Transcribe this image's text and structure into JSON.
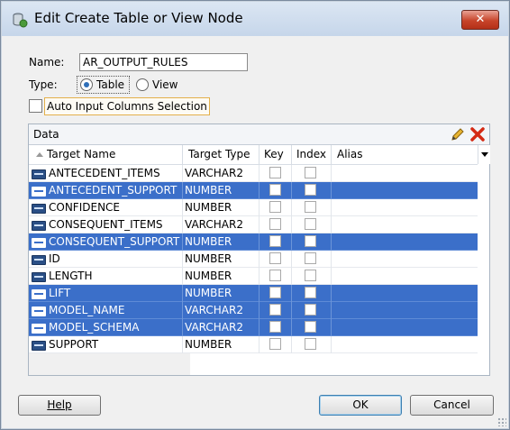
{
  "window": {
    "title": "Edit Create Table or View Node",
    "close_label": "✕"
  },
  "form": {
    "name_label": "Name:",
    "name_value": "AR_OUTPUT_RULES",
    "type_label": "Type:",
    "type_options": [
      "Table",
      "View"
    ],
    "type_selected": "Table",
    "auto_input_label": "Auto Input Columns Selection",
    "auto_input_checked": false
  },
  "data_panel": {
    "title": "Data",
    "columns": [
      "Target Name",
      "Target Type",
      "Key",
      "Index",
      "Alias"
    ],
    "rows": [
      {
        "name": "ANTECEDENT_ITEMS",
        "type": "VARCHAR2",
        "key": false,
        "index": false,
        "alias": "",
        "selected": false
      },
      {
        "name": "ANTECEDENT_SUPPORT",
        "type": "NUMBER",
        "key": false,
        "index": false,
        "alias": "",
        "selected": true
      },
      {
        "name": "CONFIDENCE",
        "type": "NUMBER",
        "key": false,
        "index": false,
        "alias": "",
        "selected": false
      },
      {
        "name": "CONSEQUENT_ITEMS",
        "type": "VARCHAR2",
        "key": false,
        "index": false,
        "alias": "",
        "selected": false
      },
      {
        "name": "CONSEQUENT_SUPPORT",
        "type": "NUMBER",
        "key": false,
        "index": false,
        "alias": "",
        "selected": true
      },
      {
        "name": "ID",
        "type": "NUMBER",
        "key": false,
        "index": false,
        "alias": "",
        "selected": false
      },
      {
        "name": "LENGTH",
        "type": "NUMBER",
        "key": false,
        "index": false,
        "alias": "",
        "selected": false
      },
      {
        "name": "LIFT",
        "type": "NUMBER",
        "key": false,
        "index": false,
        "alias": "",
        "selected": true
      },
      {
        "name": "MODEL_NAME",
        "type": "VARCHAR2",
        "key": false,
        "index": false,
        "alias": "",
        "selected": true
      },
      {
        "name": "MODEL_SCHEMA",
        "type": "VARCHAR2",
        "key": false,
        "index": false,
        "alias": "",
        "selected": true
      },
      {
        "name": "SUPPORT",
        "type": "NUMBER",
        "key": false,
        "index": false,
        "alias": "",
        "selected": false
      }
    ]
  },
  "buttons": {
    "help": "Help",
    "ok": "OK",
    "cancel": "Cancel"
  },
  "icons": {
    "title": "node-cylinder-icon",
    "edit": "pencil-icon",
    "delete": "red-x-icon",
    "column_type": "column-type-icon"
  },
  "colors": {
    "selection": "#3b6fc9",
    "title_bar": "#c6d6ea",
    "delete": "#d42a14"
  }
}
